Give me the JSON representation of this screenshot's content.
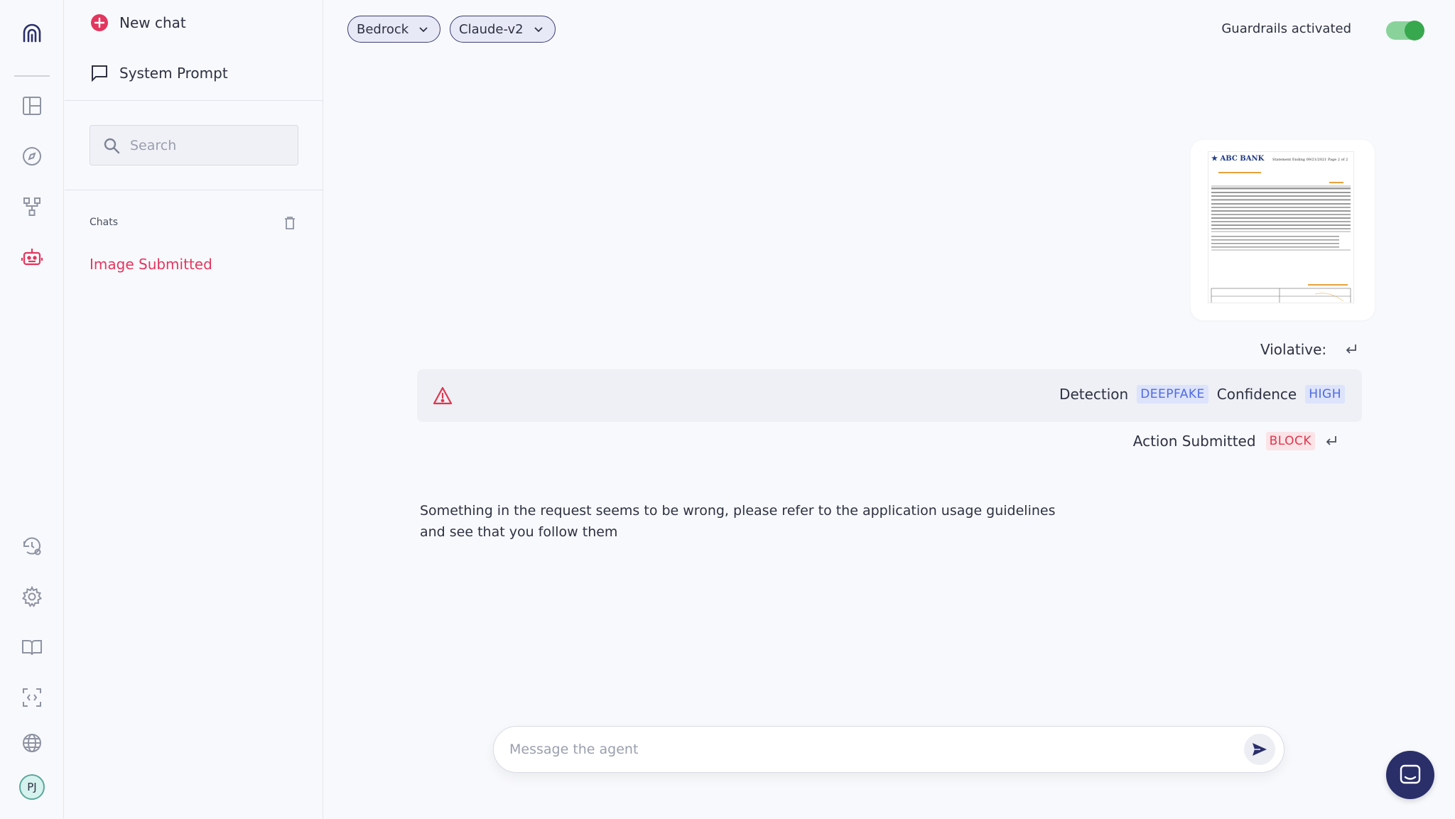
{
  "sidebar": {
    "new_chat": "New chat",
    "system_prompt": "System Prompt",
    "search_placeholder": "Search",
    "chats_label": "Chats",
    "chat_items": [
      {
        "label": "Image Submitted",
        "active": true
      }
    ]
  },
  "rail": {
    "icons": [
      "layout-icon",
      "compass-icon",
      "workflow-icon",
      "robot-icon",
      "history-settings-icon",
      "settings-icon",
      "book-icon",
      "scan-code-icon",
      "globe-icon"
    ],
    "avatar_initials": "PJ"
  },
  "header": {
    "provider": "Bedrock",
    "model": "Claude-v2",
    "guardrails_label": "Guardrails activated",
    "guardrails_on": true
  },
  "conversation": {
    "image_card": {
      "doc_title": "ABC BANK",
      "doc_subtitle": "Statement Ending 09/21/2021 Page 2 of 2"
    },
    "violative_label": "Violative:",
    "detection_label": "Detection",
    "detection_value": "DEEPFAKE",
    "confidence_label": "Confidence",
    "confidence_value": "HIGH",
    "action_label": "Action Submitted",
    "action_value": "BLOCK",
    "response_text": "Something in the request seems to be wrong, please refer to the application usage guidelines and see that you follow them"
  },
  "composer": {
    "placeholder": "Message the agent"
  },
  "colors": {
    "accent": "#e2365e",
    "brand": "#2a2f6a",
    "toggle_on": "#38a84e",
    "tag_blue": "#4f6be0",
    "tag_red": "#e0364d"
  }
}
